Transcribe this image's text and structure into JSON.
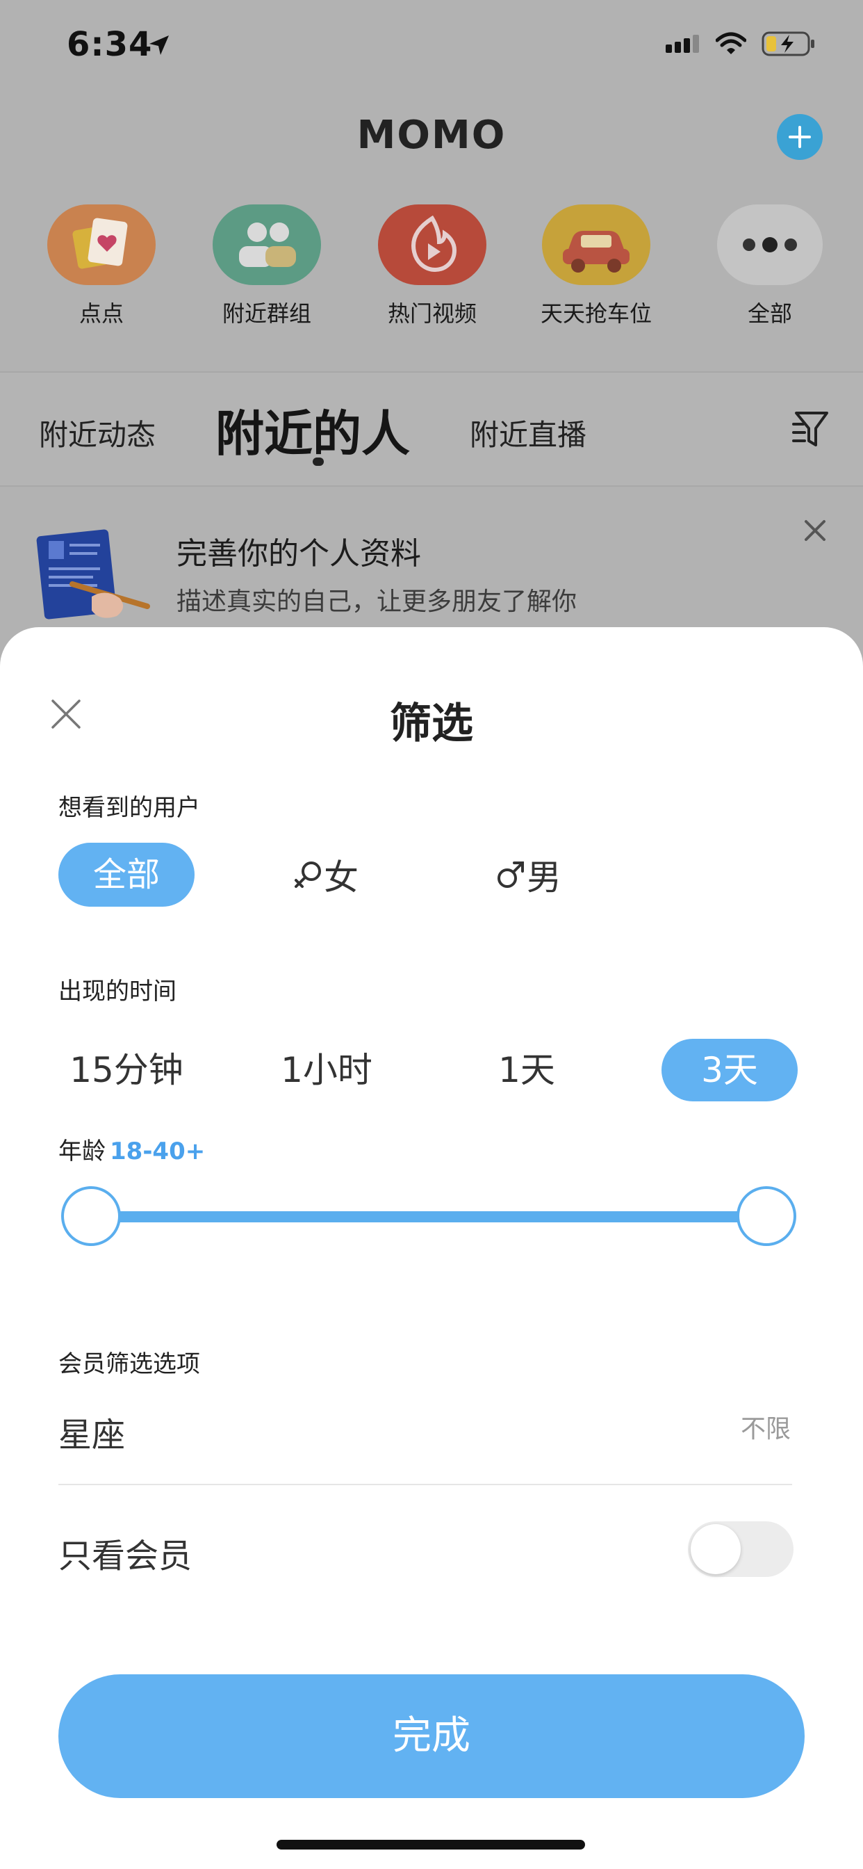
{
  "status_bar": {
    "time": "6:34"
  },
  "header": {
    "logo": "MOMO"
  },
  "apps": [
    {
      "label": "点点"
    },
    {
      "label": "附近群组"
    },
    {
      "label": "热门视频"
    },
    {
      "label": "天天抢车位"
    },
    {
      "label": "全部"
    }
  ],
  "tabs": {
    "left": "附近动态",
    "active": "附近的人",
    "right": "附近直播"
  },
  "promo": {
    "title": "完善你的个人资料",
    "subtitle": "描述真实的自己，让更多朋友了解你"
  },
  "filter_sheet": {
    "title": "筛选",
    "user_section": "想看到的用户",
    "gender_options": [
      "全部",
      "女",
      "男"
    ],
    "gender_selected": "全部",
    "time_section": "出现的时间",
    "time_options": [
      "15分钟",
      "1小时",
      "1天",
      "3天"
    ],
    "time_selected": "3天",
    "age_label": "年龄",
    "age_range": "18-40+",
    "member_section": "会员筛选选项",
    "zodiac_label": "星座",
    "zodiac_value": "不限",
    "vip_only_label": "只看会员",
    "vip_only_enabled": false,
    "done_label": "完成"
  },
  "colors": {
    "accent": "#62b2f2",
    "overlay": "#b2b2b2"
  }
}
